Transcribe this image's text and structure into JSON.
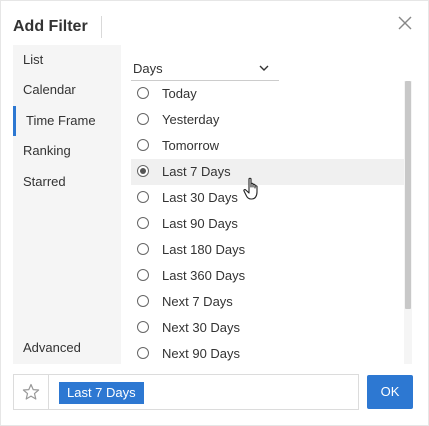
{
  "dialog": {
    "title": "Add Filter"
  },
  "sidebar": {
    "items": [
      {
        "label": "List",
        "active": false
      },
      {
        "label": "Calendar",
        "active": false
      },
      {
        "label": "Time Frame",
        "active": true
      },
      {
        "label": "Ranking",
        "active": false
      },
      {
        "label": "Starred",
        "active": false
      }
    ],
    "advanced_label": "Advanced"
  },
  "unit_select": {
    "value": "Days"
  },
  "options": [
    {
      "label": "Today",
      "selected": false
    },
    {
      "label": "Yesterday",
      "selected": false
    },
    {
      "label": "Tomorrow",
      "selected": false
    },
    {
      "label": "Last 7 Days",
      "selected": true
    },
    {
      "label": "Last 30 Days",
      "selected": false
    },
    {
      "label": "Last 90 Days",
      "selected": false
    },
    {
      "label": "Last 180 Days",
      "selected": false
    },
    {
      "label": "Last 360 Days",
      "selected": false
    },
    {
      "label": "Next 7 Days",
      "selected": false
    },
    {
      "label": "Next 30 Days",
      "selected": false
    },
    {
      "label": "Next 90 Days",
      "selected": false
    }
  ],
  "footer": {
    "selected_tag": "Last 7 Days",
    "ok_label": "OK"
  },
  "colors": {
    "accent": "#2d78d2",
    "sidebar_bg": "#f5f5f5",
    "selected_row_bg": "#f0f0f0"
  },
  "icons": {
    "close": "close-icon",
    "chevron": "chevron-down-icon",
    "star": "star-icon",
    "cursor": "hand-cursor-icon"
  }
}
